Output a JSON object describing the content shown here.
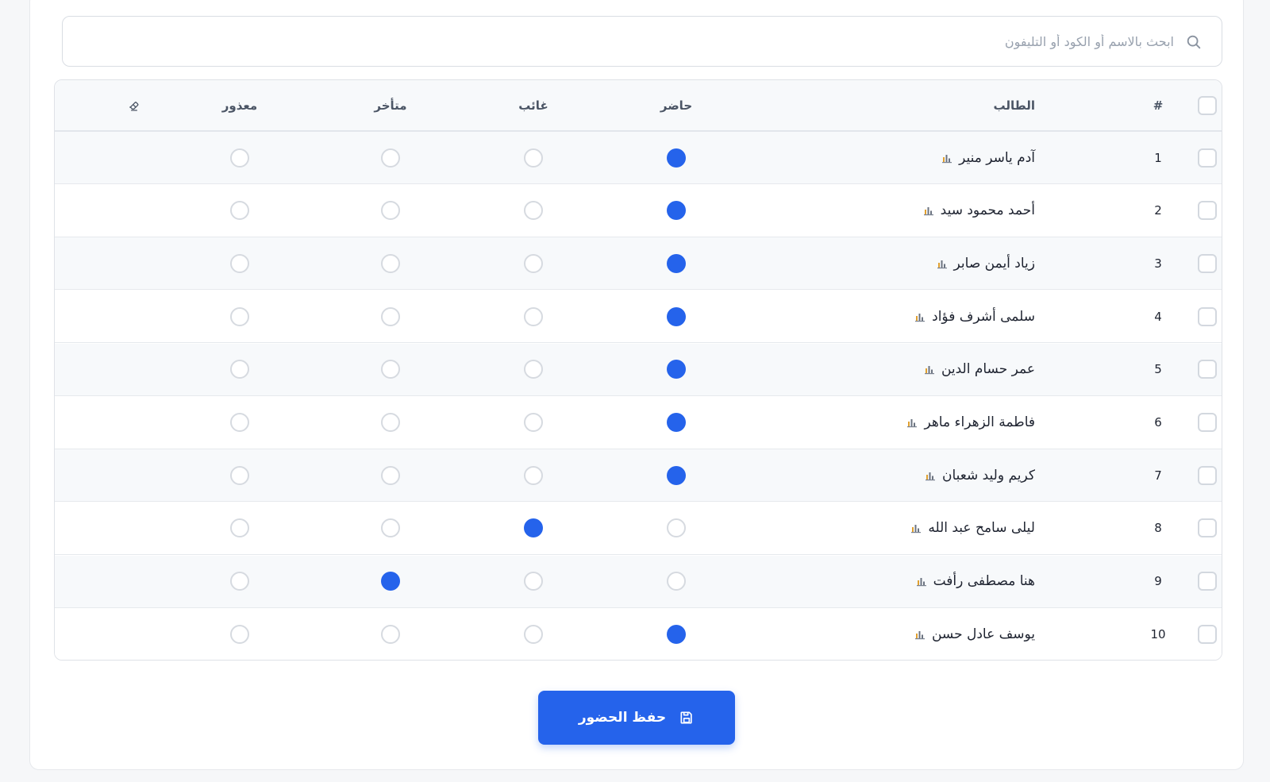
{
  "search": {
    "placeholder": "ابحث بالاسم أو الكود أو التليفون"
  },
  "table": {
    "headers": {
      "number": "#",
      "student": "الطالب",
      "present": "حاضر",
      "absent": "غائب",
      "late": "متأخر",
      "excused": "معذور"
    },
    "rows": [
      {
        "num": "1",
        "name": "آدم ياسر منير",
        "status": "present"
      },
      {
        "num": "2",
        "name": "أحمد محمود سيد",
        "status": "present"
      },
      {
        "num": "3",
        "name": "زياد أيمن صابر",
        "status": "present"
      },
      {
        "num": "4",
        "name": "سلمى أشرف فؤاد",
        "status": "present"
      },
      {
        "num": "5",
        "name": "عمر حسام الدين",
        "status": "present"
      },
      {
        "num": "6",
        "name": "فاطمة الزهراء ماهر",
        "status": "present"
      },
      {
        "num": "7",
        "name": "كريم وليد شعبان",
        "status": "present"
      },
      {
        "num": "8",
        "name": "ليلى سامح عبد الله",
        "status": "absent"
      },
      {
        "num": "9",
        "name": "هنا مصطفى رأفت",
        "status": "late"
      },
      {
        "num": "10",
        "name": "يوسف عادل حسن",
        "status": "present"
      }
    ]
  },
  "actions": {
    "save_label": "حفظ الحضور"
  },
  "colors": {
    "accent": "#2563eb",
    "border": "#dfe2e7",
    "stripe": "#f7f9fb"
  },
  "icons": {
    "search": "search-icon",
    "clear": "eraser-icon",
    "student_stats": "bar-chart-icon",
    "save": "floppy-disk-icon"
  }
}
